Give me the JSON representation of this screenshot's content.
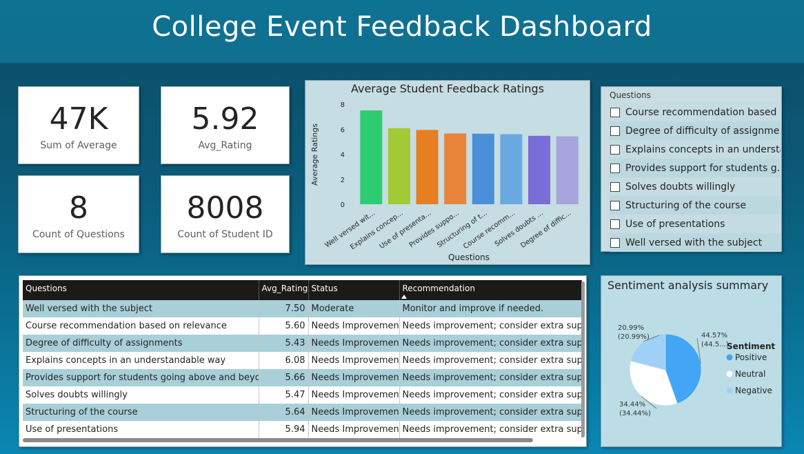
{
  "header": {
    "title": "College Event Feedback Dashboard"
  },
  "kpis": [
    {
      "value": "47K",
      "label": "Sum of Average"
    },
    {
      "value": "5.92",
      "label": "Avg_Rating"
    },
    {
      "value": "8",
      "label": "Count of Questions"
    },
    {
      "value": "8008",
      "label": "Count of Student ID"
    }
  ],
  "bar_chart": {
    "title": "Average Student Feedback Ratings"
  },
  "slicer": {
    "title": "Questions",
    "items": [
      "Course recommendation based ...",
      "Degree of difficulty of assignme...",
      "Explains concepts in an understa...",
      "Provides support for students g...",
      "Solves doubts willingly",
      "Structuring of the course",
      "Use of presentations",
      "Well versed with the subject"
    ]
  },
  "table": {
    "columns": [
      "Questions",
      "Avg_Rating",
      "Status",
      "Recommendation"
    ],
    "rows": [
      [
        "Well versed with the subject",
        "7.50",
        "Moderate",
        "Monitor and improve if needed."
      ],
      [
        "Course recommendation based on relevance",
        "5.60",
        "Needs Improvement",
        "Needs improvement; consider extra suppor"
      ],
      [
        "Degree of difficulty of assignments",
        "5.43",
        "Needs Improvement",
        "Needs improvement; consider extra suppor"
      ],
      [
        "Explains concepts in an understandable way",
        "6.08",
        "Needs Improvement",
        "Needs improvement; consider extra suppor"
      ],
      [
        "Provides support for students going above and beyond",
        "5.66",
        "Needs Improvement",
        "Needs improvement; consider extra suppor"
      ],
      [
        "Solves doubts willingly",
        "5.47",
        "Needs Improvement",
        "Needs improvement; consider extra suppor"
      ],
      [
        "Structuring of the course",
        "5.64",
        "Needs Improvement",
        "Needs improvement; consider extra suppor"
      ],
      [
        "Use of presentations",
        "5.94",
        "Needs Improvement",
        "Needs improvement; consider extra suppor"
      ]
    ]
  },
  "pie": {
    "title": "Sentiment analysis summary"
  },
  "chart_data": [
    {
      "type": "bar",
      "title": "Average Student Feedback Ratings",
      "xlabel": "Questions",
      "ylabel": "Average Ratings",
      "ylim": [
        0,
        8
      ],
      "yticks": [
        0,
        2,
        4,
        6,
        8
      ],
      "grid": false,
      "categories": [
        "Well versed wit...",
        "Explains concep...",
        "Use of presenta...",
        "Provides suppo...",
        "Structuring of t...",
        "Course recomm...",
        "Solves doubts ...",
        "Degree of diffic..."
      ],
      "values": [
        7.5,
        6.08,
        5.94,
        5.66,
        5.64,
        5.6,
        5.47,
        5.43
      ],
      "colors": [
        "#2ecc71",
        "#a3c935",
        "#e67e22",
        "#e8853a",
        "#4a90d9",
        "#6aa8e0",
        "#7b6dd8",
        "#a8a4dd"
      ]
    },
    {
      "type": "pie",
      "title": "Sentiment analysis summary",
      "legend_title": "Sentiment",
      "legend_position": "right",
      "slices": [
        {
          "label": "Positive",
          "value": 44.57,
          "text": "44.57%",
          "subtext": "(44.5...)",
          "color": "#42a5f5"
        },
        {
          "label": "Neutral",
          "value": 34.44,
          "text": "34.44%",
          "subtext": "(34.44%)",
          "color": "#ffffff"
        },
        {
          "label": "Negative",
          "value": 20.99,
          "text": "20.99%",
          "subtext": "(20.99%)",
          "color": "#9fd0f7"
        }
      ]
    }
  ]
}
